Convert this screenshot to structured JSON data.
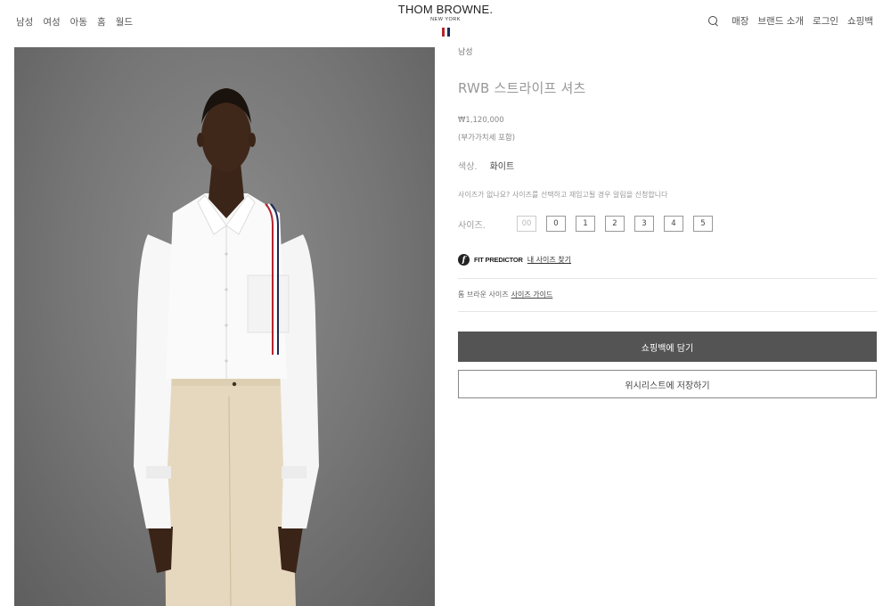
{
  "nav": {
    "left": [
      "남성",
      "여성",
      "아동",
      "홈",
      "월드"
    ],
    "right": [
      "매장",
      "브랜드 소개",
      "로그인",
      "쇼핑백"
    ]
  },
  "logo": {
    "main": "THOM BROWNE.",
    "sub": "NEW YORK"
  },
  "colors": {
    "flag_red": "#b3262e",
    "flag_navy": "#1c2a5a",
    "cart_button": "#545454"
  },
  "product": {
    "breadcrumb": "남성",
    "title": "RWB 스트라이프 셔츠",
    "price": "₩1,120,000",
    "vat": "(부가가치세 포함)",
    "color_label": "색상.",
    "color_value": "화이트",
    "size_note": "사이즈가 없나요? 사이즈를 선택하고 재입고될 경우 알림을 신청합니다",
    "size_label": "사이즈.",
    "sizes": [
      {
        "label": "00",
        "available": false
      },
      {
        "label": "0",
        "available": true
      },
      {
        "label": "1",
        "available": true
      },
      {
        "label": "2",
        "available": true
      },
      {
        "label": "3",
        "available": true
      },
      {
        "label": "4",
        "available": true
      },
      {
        "label": "5",
        "available": true
      }
    ],
    "fit_brand": "FIT PREDICTOR",
    "fit_link": "내 사이즈 찾기",
    "guide_prefix": "톰 브라운 사이즈",
    "guide_link": "사이즈 가이드",
    "add_to_cart": "쇼핑백에 담기",
    "wishlist": "위시리스트에 저장하기"
  }
}
